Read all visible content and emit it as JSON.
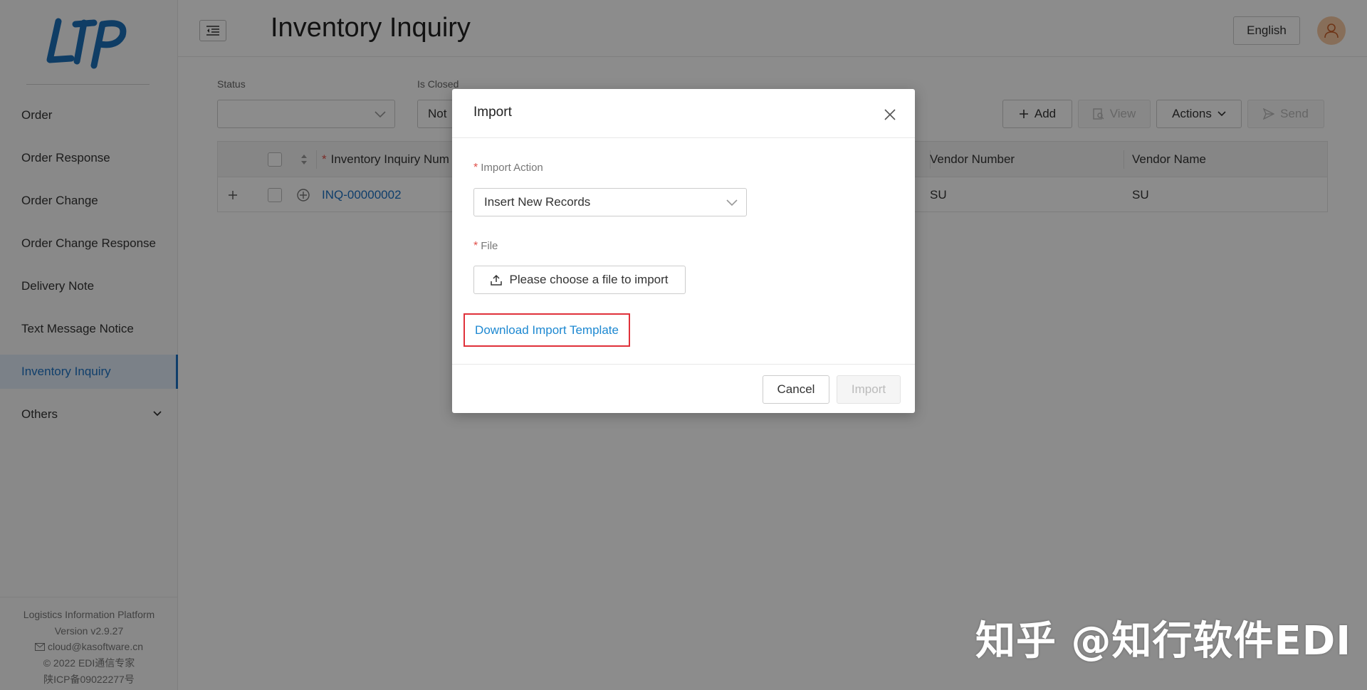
{
  "app": {
    "logo_text": "LIP",
    "page_title": "Inventory Inquiry"
  },
  "sidebar": {
    "items": [
      {
        "label": "Order"
      },
      {
        "label": "Order Response"
      },
      {
        "label": "Order Change"
      },
      {
        "label": "Order Change Response"
      },
      {
        "label": "Delivery Note"
      },
      {
        "label": "Text Message Notice"
      },
      {
        "label": "Inventory Inquiry",
        "active": true
      },
      {
        "label": "Others"
      }
    ],
    "footer": {
      "platform": "Logistics Information Platform",
      "version": "Version v2.9.27",
      "email": "cloud@kasoftware.cn",
      "copyright": "© 2022 EDI通信专家",
      "icp": "陕ICP备09022277号"
    }
  },
  "header": {
    "language": "English"
  },
  "filters": {
    "status": {
      "label": "Status",
      "value": ""
    },
    "is_closed": {
      "label": "Is Closed",
      "value": "Not"
    }
  },
  "toolbar": {
    "add": "Add",
    "view": "View",
    "actions": "Actions",
    "send": "Send"
  },
  "table": {
    "columns": [
      "Inventory Inquiry Num",
      "Vendor Number",
      "Vendor Name"
    ],
    "rows": [
      {
        "inquiry_number": "INQ-00000002",
        "vendor_number": "SU",
        "vendor_name": "SU"
      }
    ]
  },
  "modal": {
    "title": "Import",
    "import_action_label": "Import Action",
    "import_action_value": "Insert New Records",
    "file_label": "File",
    "file_button": "Please choose a file to import",
    "template_link": "Download Import Template",
    "cancel": "Cancel",
    "import": "Import"
  },
  "watermark": "知乎 @知行软件EDI",
  "colors": {
    "accent": "#1d72c4",
    "link": "#1d88d1",
    "highlight": "#e0313a",
    "required": "#e0504a"
  }
}
